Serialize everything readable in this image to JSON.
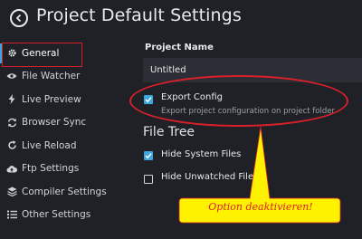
{
  "header": {
    "title": "Project Default Settings"
  },
  "sidebar": {
    "items": [
      {
        "label": "General",
        "icon": "gear-icon",
        "active": true
      },
      {
        "label": "File Watcher",
        "icon": "eye-icon"
      },
      {
        "label": "Live Preview",
        "icon": "bolt-icon"
      },
      {
        "label": "Browser Sync",
        "icon": "sync-icon"
      },
      {
        "label": "Live Reload",
        "icon": "reload-icon"
      },
      {
        "label": "Ftp Settings",
        "icon": "cloud-upload-icon"
      },
      {
        "label": "Compiler Settings",
        "icon": "layers-icon"
      },
      {
        "label": "Other Settings",
        "icon": "list-icon"
      }
    ]
  },
  "main": {
    "project_name_label": "Project Name",
    "project_name_value": "Untitled",
    "export_config": {
      "label": "Export Config",
      "description": "Export project configuration on project folder",
      "checked": true
    },
    "file_tree_title": "File Tree",
    "hide_system_files": {
      "label": "Hide System Files",
      "checked": true
    },
    "hide_unwatched_files": {
      "label": "Hide Unwatched Files",
      "checked": false
    }
  },
  "annotation": {
    "callout_text": "Option deaktivieren!"
  },
  "colors": {
    "accent": "#3aa7e0",
    "annotation_red": "#d9202a",
    "callout_yellow": "#fff200",
    "background": "#1f2126"
  }
}
